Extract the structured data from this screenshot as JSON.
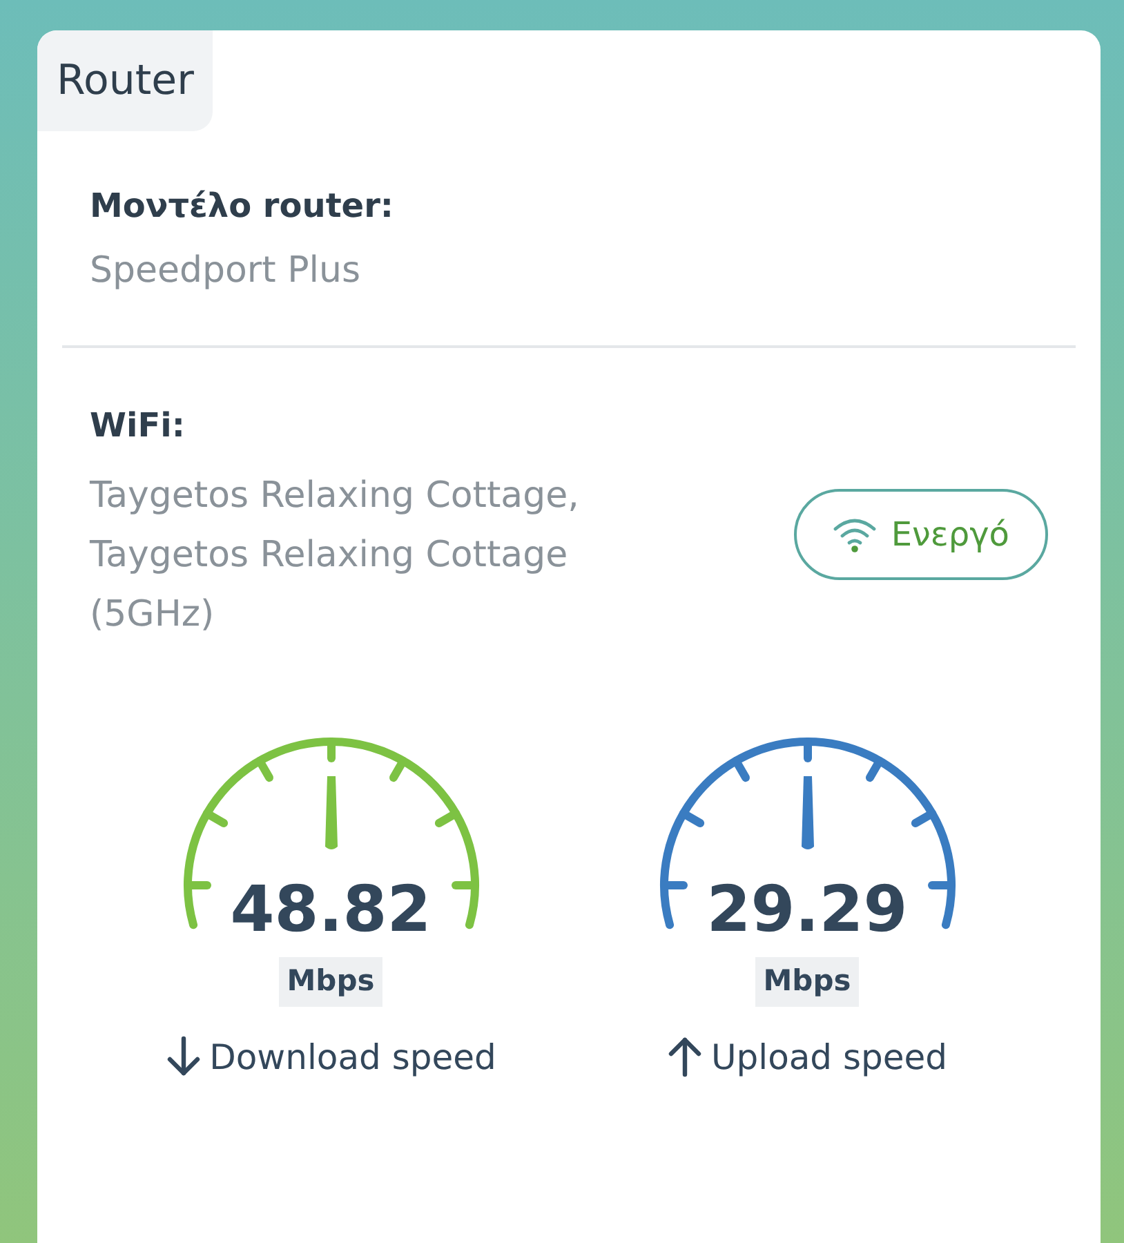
{
  "tab": {
    "label": "Router",
    "selected": true
  },
  "model": {
    "label": "Μοντέλο router:",
    "value": "Speedport Plus"
  },
  "wifi": {
    "label": "WiFi:",
    "value": "Taygetos Relaxing Cottage, Taygetos Relaxing Cottage (5GHz)",
    "status": {
      "label": "Ενεργό",
      "active": true
    }
  },
  "speeds": [
    {
      "value": "48.82",
      "unit": "Mbps",
      "label": "Download speed",
      "kind": "download",
      "color": "#7dc243"
    },
    {
      "value": "29.29",
      "unit": "Mbps",
      "label": "Upload speed",
      "kind": "upload",
      "color": "#3a7cc1"
    }
  ]
}
